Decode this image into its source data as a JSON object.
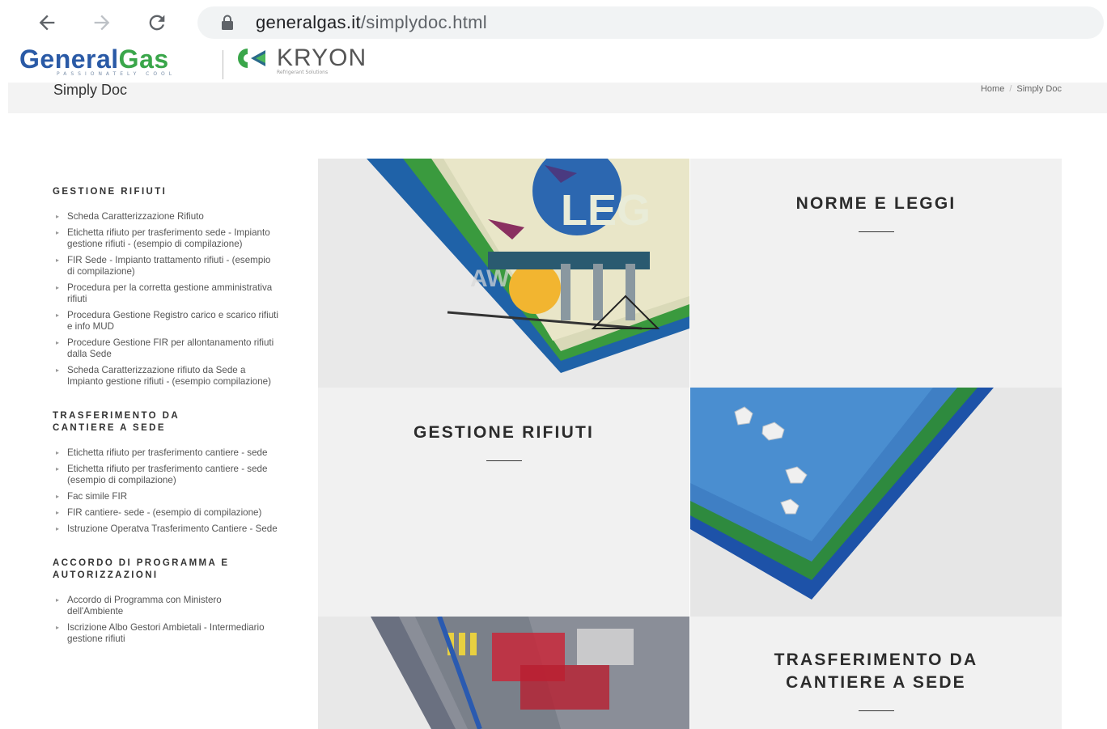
{
  "browser": {
    "url_host": "generalgas.it",
    "url_path": "/simplydoc.html"
  },
  "header": {
    "logo_general": "General",
    "logo_gas": "Gas",
    "logo_tagline": "PASSIONATELY COOL",
    "kryon_name": "KRYON",
    "kryon_sub": "Refrigerant Solutions"
  },
  "title_bar": {
    "title": "Simply Doc",
    "breadcrumb": [
      "Home",
      "Simply Doc"
    ]
  },
  "sidebar": {
    "sections": [
      {
        "heading": "GESTIONE RIFIUTI",
        "items": [
          "Scheda Caratterizzazione Rifiuto",
          "Etichetta rifiuto per trasferimento sede - Impianto gestione rifiuti - (esempio di compilazione)",
          "FIR Sede - Impianto trattamento rifiuti - (esempio di compilazione)",
          "Procedura per la corretta gestione amministrativa rifiuti",
          "Procedura Gestione Registro carico e scarico rifiuti e info MUD",
          "Procedure Gestione FIR per allontanamento rifiuti dalla Sede",
          "Scheda Caratterizzazione rifiuto da Sede a Impianto gestione rifiuti - (esempio compilazione)"
        ]
      },
      {
        "heading": "TRASFERIMENTO DA CANTIERE A SEDE",
        "items": [
          "Etichetta rifiuto per trasferimento cantiere - sede",
          "Etichetta rifiuto per trasferimento cantiere - sede (esempio di compilazione)",
          "Fac simile FIR",
          "FIR cantiere- sede - (esempio di compilazione)",
          "Istruzione Operatva Trasferimento Cantiere - Sede"
        ]
      },
      {
        "heading": "ACCORDO DI PROGRAMMA E AUTORIZZAZIONI",
        "items": [
          "Accordo di Programma con Ministero dell'Ambiente",
          "Iscrizione Albo Gestori Ambietali - Intermediario gestione rifiuti"
        ]
      }
    ]
  },
  "tiles": {
    "norme": "NORME E LEGGI",
    "gestione": "GESTIONE RIFIUTI",
    "trasferimento_line1": "TRASFERIMENTO DA",
    "trasferimento_line2": "CANTIERE A SEDE",
    "legal_image_text": "LEG",
    "legal_image_text2": "AW"
  },
  "colors": {
    "brand_blue": "#2a5aa6",
    "brand_green": "#3aa64a",
    "tile_bg": "#f1f1f1"
  }
}
